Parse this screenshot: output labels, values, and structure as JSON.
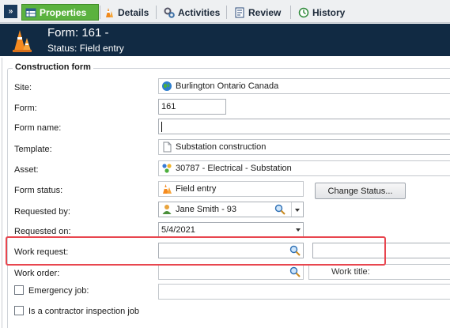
{
  "tabs": [
    {
      "label": "Properties",
      "icon": "table-icon"
    },
    {
      "label": "Details",
      "icon": "cone-icon"
    },
    {
      "label": "Activities",
      "icon": "gears-icon"
    },
    {
      "label": "Review",
      "icon": "review-icon"
    },
    {
      "label": "History",
      "icon": "history-icon"
    }
  ],
  "header": {
    "title": "Form: 161 -",
    "status": "Status: Field entry"
  },
  "form": {
    "legend": "Construction form",
    "site": {
      "label": "Site:",
      "value": "Burlington Ontario Canada",
      "icon": "globe-icon"
    },
    "form": {
      "label": "Form:",
      "value": "161"
    },
    "form_name": {
      "label": "Form name:",
      "value": ""
    },
    "template": {
      "label": "Template:",
      "value": "Substation construction",
      "icon": "document-icon"
    },
    "asset": {
      "label": "Asset:",
      "value": "30787 - Electrical - Substation",
      "icon": "asset-icon"
    },
    "form_status": {
      "label": "Form status:",
      "value": "Field entry",
      "icon": "cone-icon",
      "button": "Change Status..."
    },
    "requested_by": {
      "label": "Requested by:",
      "value": "Jane Smith - 93",
      "icon": "person-icon"
    },
    "requested_on": {
      "label": "Requested on:",
      "value": "5/4/2021"
    },
    "work_request": {
      "label": "Work request:",
      "value": ""
    },
    "work_order": {
      "label": "Work order:",
      "value": ""
    },
    "work_title": {
      "label": "Work title:",
      "value": ""
    },
    "emergency_job": {
      "label": "Emergency job:",
      "checked": false
    },
    "contractor_inspection": {
      "label": "Is a contractor inspection job",
      "checked": false
    }
  },
  "colors": {
    "header_bg": "#112a43",
    "active_tab": "#5bb23f",
    "highlight": "#e8464f"
  }
}
